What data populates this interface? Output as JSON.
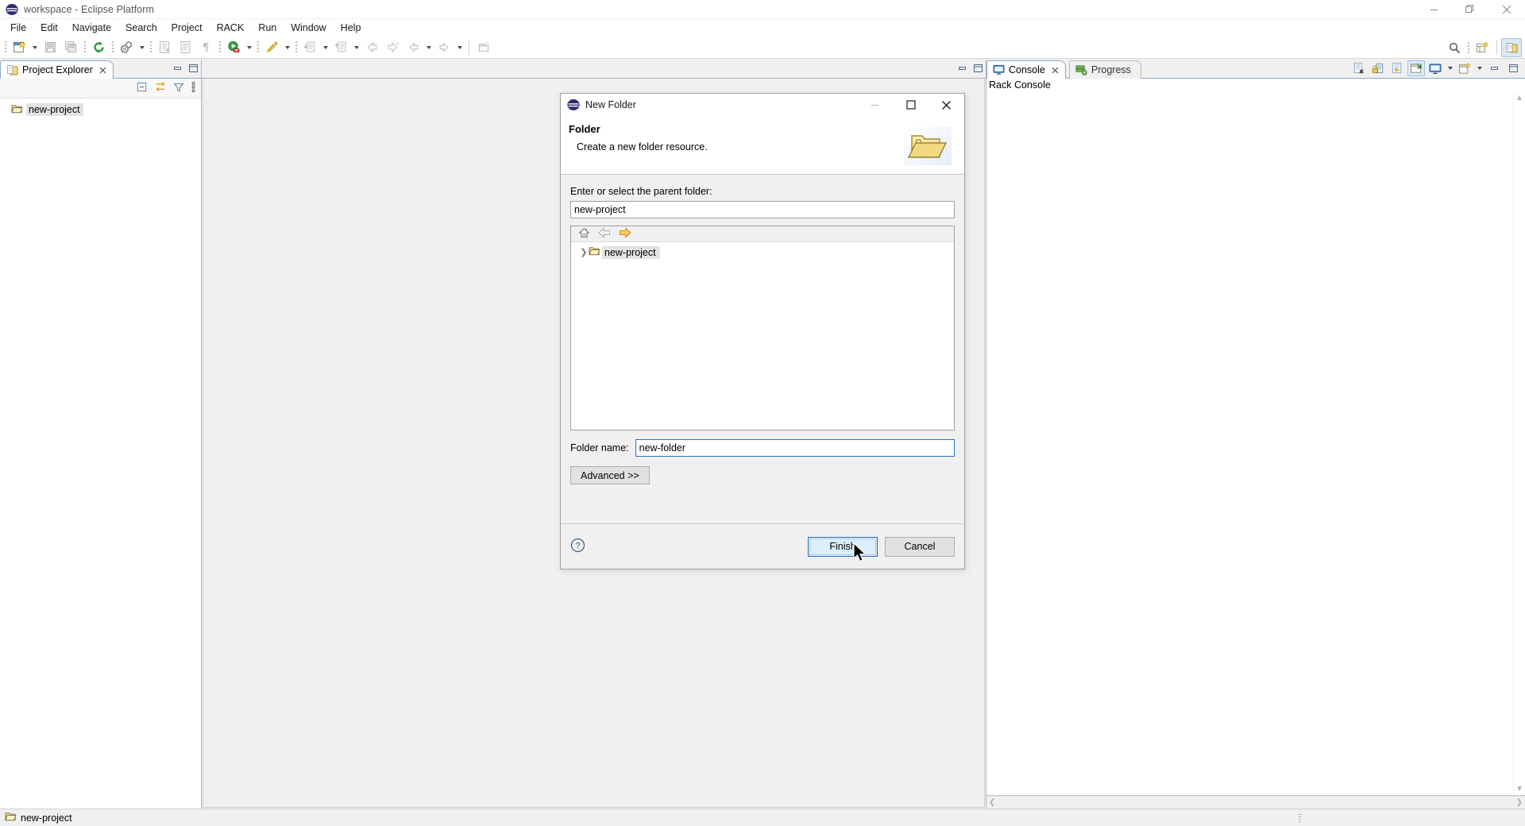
{
  "window": {
    "title": "workspace - Eclipse Platform",
    "logo_icon": "eclipse-logo-icon",
    "minimize_label": "Minimize",
    "restore_label": "Restore",
    "close_label": "Close"
  },
  "menubar": {
    "items": [
      {
        "label": "File"
      },
      {
        "label": "Edit"
      },
      {
        "label": "Navigate"
      },
      {
        "label": "Search"
      },
      {
        "label": "Project"
      },
      {
        "label": "RACK"
      },
      {
        "label": "Run"
      },
      {
        "label": "Window"
      },
      {
        "label": "Help"
      }
    ]
  },
  "toolbar": {
    "items": [
      {
        "name": "new-wizard-icon",
        "dropdown": true
      },
      {
        "name": "save-icon",
        "dropdown": false
      },
      {
        "name": "save-all-icon",
        "dropdown": false
      },
      {
        "name": "refresh-icon",
        "dropdown": false
      },
      {
        "name": "build-gears-icon",
        "dropdown": true
      },
      {
        "name": "open-type-icon",
        "dropdown": false
      },
      {
        "name": "open-task-icon",
        "dropdown": false
      },
      {
        "name": "pilcrow-icon",
        "dropdown": false
      },
      {
        "name": "run-icon",
        "dropdown": true
      },
      {
        "name": "profile-icon",
        "dropdown": true
      },
      {
        "name": "debug-step-icon",
        "dropdown": true
      },
      {
        "name": "external-tools-icon",
        "dropdown": true
      },
      {
        "name": "prev-annotation-icon",
        "dropdown": false
      },
      {
        "name": "next-annotation-icon",
        "dropdown": false
      },
      {
        "name": "back-nav-icon",
        "dropdown": true
      },
      {
        "name": "forward-nav-icon",
        "dropdown": true
      },
      {
        "name": "new-editor-icon",
        "dropdown": false
      }
    ],
    "right_items": [
      {
        "name": "search-icon"
      },
      {
        "name": "new-perspective-icon"
      },
      {
        "name": "resource-perspective-icon",
        "selected": true
      }
    ]
  },
  "explorer": {
    "tab_label": "Project Explorer",
    "tab_icon": "project-explorer-icon",
    "close_icon": "close-icon",
    "minimize_icon": "minimize-icon",
    "maximize_icon": "maximize-icon",
    "view_toolbar": [
      {
        "name": "collapse-all-icon"
      },
      {
        "name": "link-with-editor-icon"
      },
      {
        "name": "filter-icon"
      },
      {
        "name": "view-menu-icon"
      }
    ],
    "tree": [
      {
        "label": "new-project",
        "icon": "folder-open-icon",
        "selected": true
      }
    ]
  },
  "editor": {
    "minimize_icon": "minimize-icon",
    "maximize_icon": "maximize-icon"
  },
  "console": {
    "tabs": [
      {
        "label": "Console",
        "icon": "console-icon",
        "active": true,
        "closable": true
      },
      {
        "label": "Progress",
        "icon": "progress-icon",
        "active": false,
        "closable": false
      }
    ],
    "title": "Rack Console",
    "content": "",
    "tools": [
      {
        "name": "clear-console-icon"
      },
      {
        "name": "scroll-lock-icon"
      },
      {
        "name": "word-wrap-icon"
      },
      {
        "name": "pin-console-icon",
        "selected": true
      },
      {
        "name": "display-selected-console-icon",
        "dropdown": true
      },
      {
        "name": "open-console-icon",
        "dropdown": true
      },
      {
        "name": "minimize-icon"
      },
      {
        "name": "maximize-icon"
      }
    ],
    "scroll_left_icon": "chevron-left-icon",
    "scroll_right_icon": "chevron-right-icon"
  },
  "statusbar": {
    "icon": "folder-open-icon",
    "label": "new-project"
  },
  "dialog": {
    "title": "New Folder",
    "title_icon": "eclipse-logo-icon",
    "minimize_label": "Minimize",
    "maximize_label": "Maximize",
    "close_label": "Close",
    "header_title": "Folder",
    "header_desc": "Create a new folder resource.",
    "header_image": "folder-banner-icon",
    "parent_label": "Enter or select the parent folder:",
    "parent_value": "new-project",
    "tree_toolbar": [
      {
        "name": "home-icon"
      },
      {
        "name": "back-arrow-icon"
      },
      {
        "name": "forward-arrow-icon"
      }
    ],
    "tree_items": [
      {
        "label": "new-project",
        "icon": "folder-open-icon",
        "expandable": true,
        "selected": true
      }
    ],
    "folder_name_label": "Folder name:",
    "folder_name_value": "new-folder",
    "advanced_label": "Advanced >>",
    "help_icon": "help-icon",
    "finish_label": "Finish",
    "cancel_label": "Cancel"
  },
  "colors": {
    "accent_blue": "#2a6fb5",
    "tab_blue": "#8ba7c4",
    "primary_button_bg": "#dceefb",
    "selection_grey": "#e3e3e3",
    "panel_bg": "#f0f0f0",
    "folder_yellow": "#f5d97a"
  }
}
